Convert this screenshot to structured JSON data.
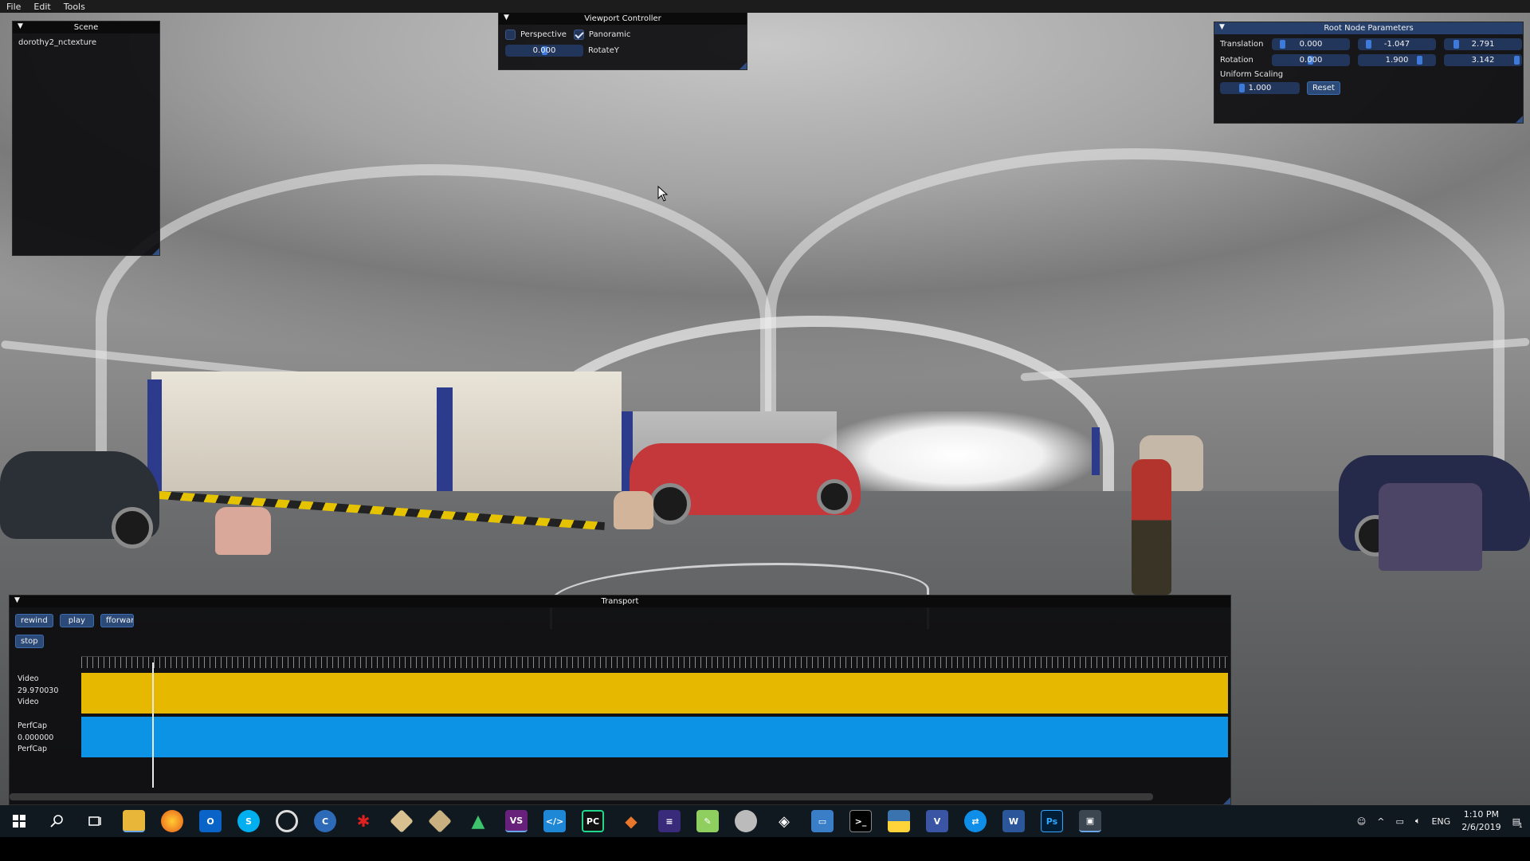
{
  "menubar": {
    "items": [
      "File",
      "Edit",
      "Tools"
    ]
  },
  "scene_panel": {
    "title": "Scene",
    "items": [
      "dorothy2_nctexture"
    ]
  },
  "viewport_controller": {
    "title": "Viewport Controller",
    "perspective_label": "Perspective",
    "perspective_checked": false,
    "panoramic_label": "Panoramic",
    "panoramic_checked": true,
    "rotate_value": "0.000",
    "rotate_label": "RotateY"
  },
  "root_node": {
    "title": "Root Node Parameters",
    "translation_label": "Translation",
    "translation": [
      "0.000",
      "-1.047",
      "2.791"
    ],
    "rotation_label": "Rotation",
    "rotation": [
      "0.000",
      "1.900",
      "3.142"
    ],
    "scaling_label": "Uniform Scaling",
    "scaling": "1.000",
    "reset_label": "Reset"
  },
  "transport": {
    "title": "Transport",
    "rewind_label": "rewind",
    "play_label": "play",
    "fforward_label": "fforward",
    "stop_label": "stop",
    "tracks": [
      {
        "name": "Video",
        "rate": "29.970030",
        "type": "Video",
        "color": "#e6b800"
      },
      {
        "name": "PerfCap",
        "rate": "0.000000",
        "type": "PerfCap",
        "color": "#0d93e6"
      }
    ]
  },
  "taskbar": {
    "icons": [
      "windows-start-icon",
      "search-icon",
      "task-view-icon",
      "file-explorer-icon",
      "firefox-icon",
      "outlook-icon",
      "skype-icon",
      "browser-icon",
      "cmake-icon",
      "red-app-icon",
      "git-icon",
      "git-alt-icon",
      "triangle-app-icon",
      "visual-studio-icon",
      "vscode-icon",
      "pycharm-icon",
      "matlab-icon",
      "blender-icon",
      "notepad-icon",
      "disk-app-icon",
      "unity-icon",
      "remote-icon",
      "terminal-icon",
      "python-icon",
      "visio-icon",
      "teamviewer-icon",
      "word-icon",
      "photoshop-icon",
      "active-app-icon"
    ],
    "language": "ENG",
    "time": "1:10 PM",
    "date": "2/6/2019",
    "notification_count": "1"
  }
}
